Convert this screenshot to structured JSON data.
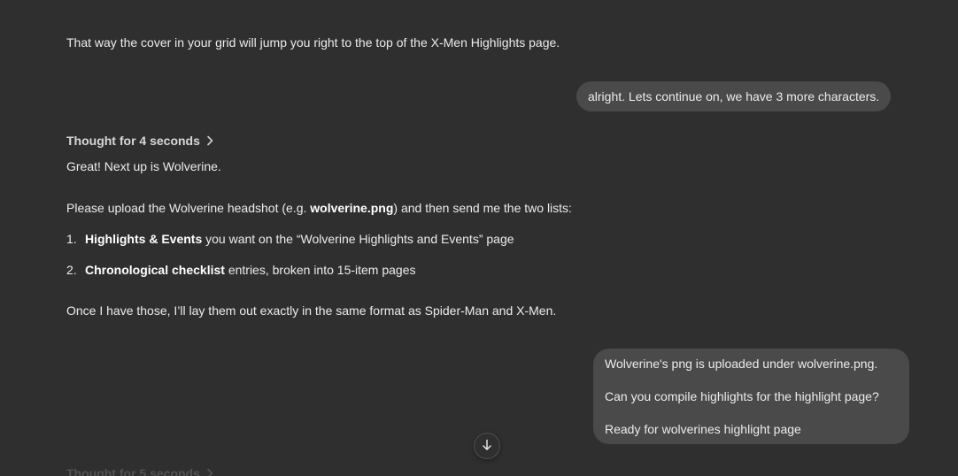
{
  "conversation": {
    "prev_assistant_tail": "That way the cover in your grid will jump you right to the top of the X-Men Highlights page.",
    "user_message_1": "alright.  Lets continue on, we have 3 more characters.",
    "thought_1": "Thought for 4 seconds",
    "assistant_reply": {
      "intro": "Great! Next up is Wolverine.",
      "upload_pre": "Please upload the Wolverine headshot (e.g. ",
      "upload_bold": "wolverine.png",
      "upload_post": ") and then send me the two lists:",
      "list": [
        {
          "num": "1.",
          "bold": "Highlights & Events",
          "rest": " you want on the “Wolverine Highlights and Events” page"
        },
        {
          "num": "2.",
          "bold": "Chronological checklist",
          "rest": " entries, broken into 15-item pages"
        }
      ],
      "closing": "Once I have those, I’ll lay them out exactly in the same format as Spider-Man and X-Men."
    },
    "user_message_2": {
      "line1": "Wolverine's png is uploaded under wolverine.png.",
      "line2": "Can you compile highlights for the highlight page?",
      "line3": "Ready for wolverines highlight page"
    },
    "thought_2": "Thought for 5 seconds"
  },
  "controls": {
    "scroll_down_icon": "arrow-down-icon",
    "thought_chevron_icon": "chevron-right-icon"
  },
  "colors": {
    "background": "#2f2f2f",
    "bubble": "#4a4a4a",
    "text": "#ececec"
  }
}
